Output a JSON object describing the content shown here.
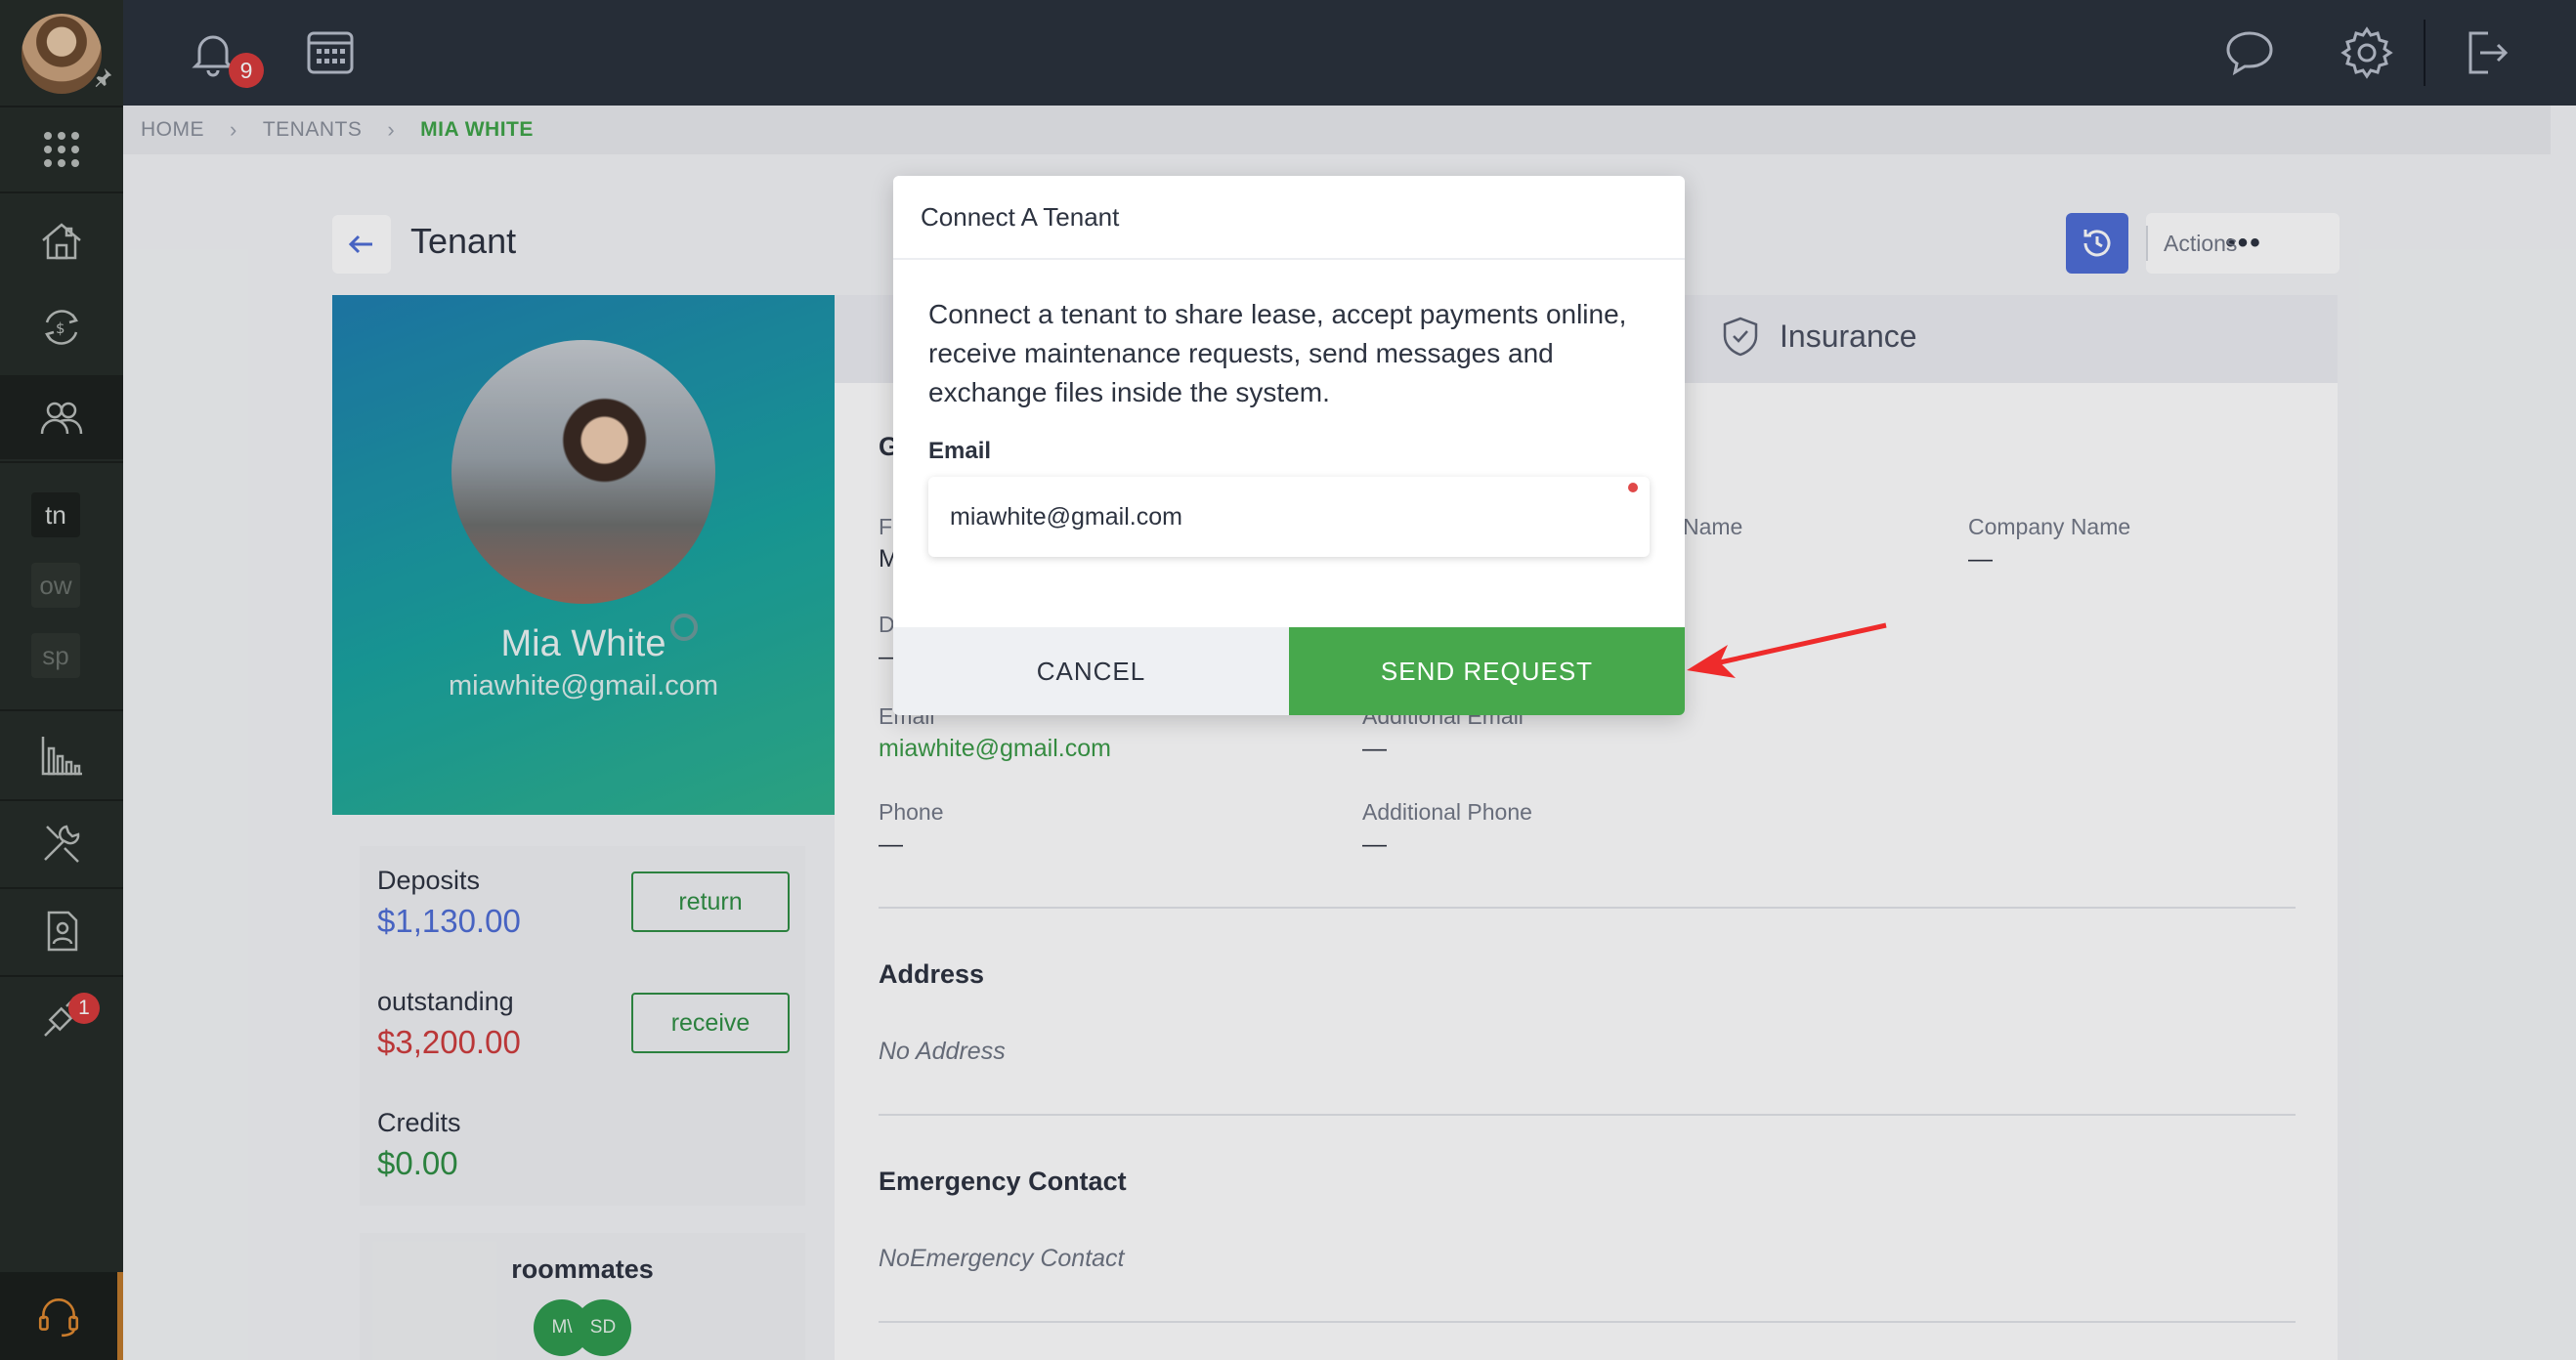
{
  "topbar": {
    "notification_count": "9"
  },
  "sidebar": {
    "workspaces": [
      "tn",
      "ow",
      "sp"
    ],
    "tools_badge": "1"
  },
  "breadcrumb": {
    "home": "HOME",
    "tenants": "TENANTS",
    "current": "MIA WHITE"
  },
  "page": {
    "title": "Tenant",
    "actions_label": "Actions"
  },
  "profile": {
    "name": "Mia White",
    "email": "miawhite@gmail.com"
  },
  "balances": {
    "deposits_label": "Deposits",
    "deposits_value": "$1,130.00",
    "return_label": "return",
    "outstanding_label": "outstanding",
    "outstanding_value": "$3,200.00",
    "receive_label": "receive",
    "credits_label": "Credits",
    "credits_value": "$0.00"
  },
  "roommates": {
    "title": "roommates",
    "initials": [
      "M\\",
      "SD"
    ]
  },
  "details": {
    "insurance_tab": "Insurance",
    "section_partial": "G",
    "first_partial": "F",
    "first_value_partial": "M",
    "d_partial": "D",
    "dash": "—",
    "name_label": "Name",
    "company_label": "Company Name",
    "email_label": "Email",
    "email_value": "miawhite@gmail.com",
    "additional_email_label": "Additional Email",
    "phone_label": "Phone",
    "additional_phone_label": "Additional Phone",
    "address_title": "Address",
    "address_empty": "No Address",
    "emergency_title": "Emergency Contact",
    "emergency_empty": "NoEmergency Contact"
  },
  "modal": {
    "title": "Connect A Tenant",
    "description": "Connect a tenant to share lease, accept payments online, receive maintenance requests, send messages and exchange files inside the system.",
    "email_label": "Email",
    "email_value": "miawhite@gmail.com",
    "cancel_label": "CANCEL",
    "send_label": "SEND REQUEST"
  },
  "colors": {
    "accent_green": "#47a84c",
    "sidebar_bg": "#252c27",
    "topbar_bg": "#2a313c",
    "badge_red": "#d93a3a",
    "primary_blue": "#4f6ed6"
  }
}
